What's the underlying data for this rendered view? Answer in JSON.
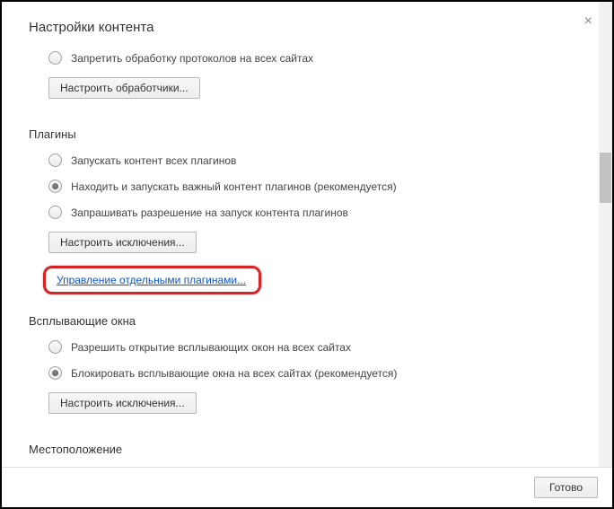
{
  "title": "Настройки контента",
  "close_glyph": "×",
  "protocols": {
    "opt1": "Запретить обработку протоколов на всех сайтах",
    "btn": "Настроить обработчики..."
  },
  "plugins": {
    "heading": "Плагины",
    "opt1": "Запускать контент всех плагинов",
    "opt2": "Находить и запускать важный контент плагинов (рекомендуется)",
    "opt3": "Запрашивать разрешение на запуск контента плагинов",
    "exceptions_btn": "Настроить исключения...",
    "manage_link": "Управление отдельными плагинами..."
  },
  "popups": {
    "heading": "Всплывающие окна",
    "opt1": "Разрешить открытие всплывающих окон на всех сайтах",
    "opt2": "Блокировать всплывающие окна на всех сайтах (рекомендуется)",
    "exceptions_btn": "Настроить исключения..."
  },
  "location": {
    "heading": "Местоположение"
  },
  "footer": {
    "done": "Готово"
  }
}
